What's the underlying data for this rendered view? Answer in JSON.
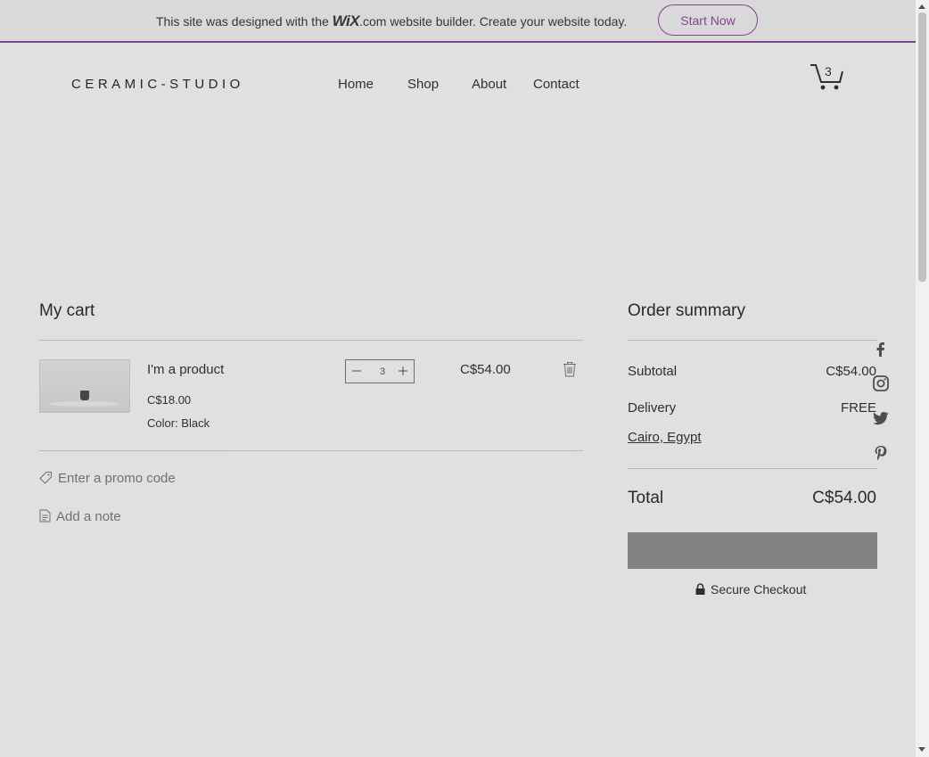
{
  "banner": {
    "text_before": "This site was designed with the ",
    "logo_wix": "WiX",
    "logo_com": ".com",
    "text_after": " website builder. Create your website today.",
    "button": "Start Now",
    "accent_color": "#8a4d9a"
  },
  "header": {
    "brand": "CERAMIC-STUDIO",
    "nav": [
      "Home",
      "Shop",
      "About",
      "Contact"
    ],
    "cart_count": "3"
  },
  "cart": {
    "title": "My cart",
    "item": {
      "name": "I'm a product",
      "price": "C$18.00",
      "color": "Color: Black",
      "quantity": "3",
      "line_total": "C$54.00"
    },
    "promo": "Enter a promo code",
    "note": "Add a note"
  },
  "summary": {
    "title": "Order summary",
    "subtotal_label": "Subtotal",
    "subtotal_value": "C$54.00",
    "delivery_label": "Delivery",
    "delivery_value": "FREE",
    "location": "Cairo, Egypt",
    "total_label": "Total",
    "total_value": "C$54.00",
    "secure": "Secure Checkout"
  },
  "social": [
    "facebook-icon",
    "instagram-icon",
    "twitter-icon",
    "pinterest-icon"
  ]
}
